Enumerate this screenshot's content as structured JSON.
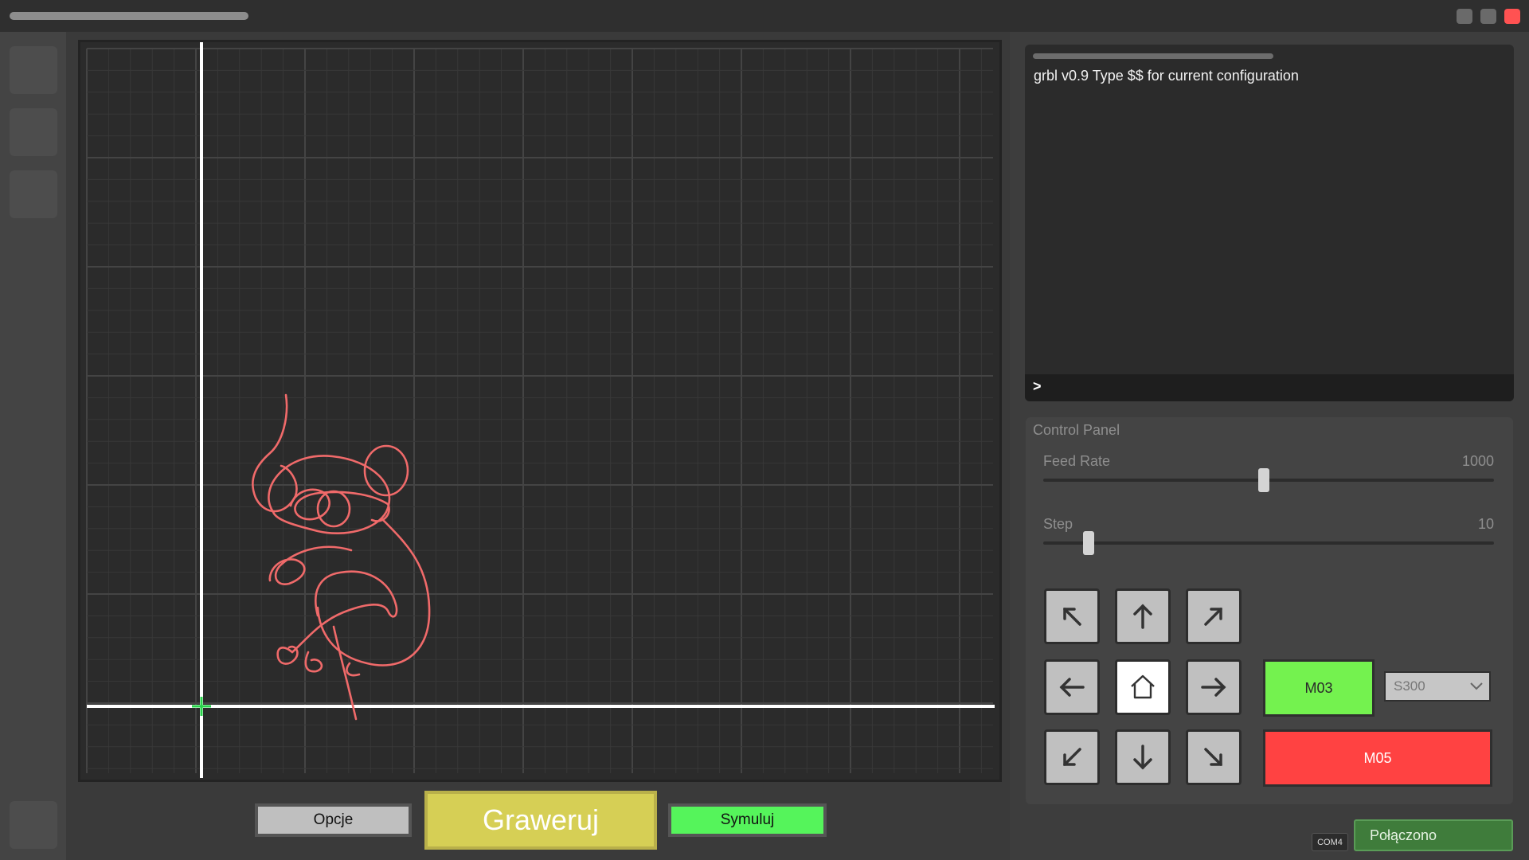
{
  "console": {
    "output_line": "grbl v0.9 Type $$ for current configuration",
    "prompt": ">"
  },
  "control_panel": {
    "title": "Control Panel",
    "feed_rate": {
      "label": "Feed Rate",
      "value": "1000",
      "position_fraction": 0.49
    },
    "step": {
      "label": "Step",
      "value": "10",
      "position_fraction": 0.09
    }
  },
  "jog": {
    "up_left_icon": "arrow-up-left-icon",
    "up_icon": "arrow-up-icon",
    "up_right_icon": "arrow-up-right-icon",
    "left_icon": "arrow-left-icon",
    "home_icon": "home-icon",
    "right_icon": "arrow-right-icon",
    "down_left_icon": "arrow-down-left-icon",
    "down_icon": "arrow-down-icon",
    "down_right_icon": "arrow-down-right-icon"
  },
  "spindle": {
    "m03_label": "M03",
    "m05_label": "M05",
    "power_selected": "S300"
  },
  "actions": {
    "options_label": "Opcje",
    "engrave_label": "Graweruj",
    "simulate_label": "Symuluj"
  },
  "connection": {
    "port": "COM4",
    "status": "Połączono"
  },
  "colors": {
    "engrave": "#d6cf55",
    "simulate": "#55f45b",
    "m03": "#74f24f",
    "m05": "#ff4242",
    "drawing": "#f06a6a",
    "origin_marker": "#27d44a",
    "connected": "#3f7c3b"
  }
}
